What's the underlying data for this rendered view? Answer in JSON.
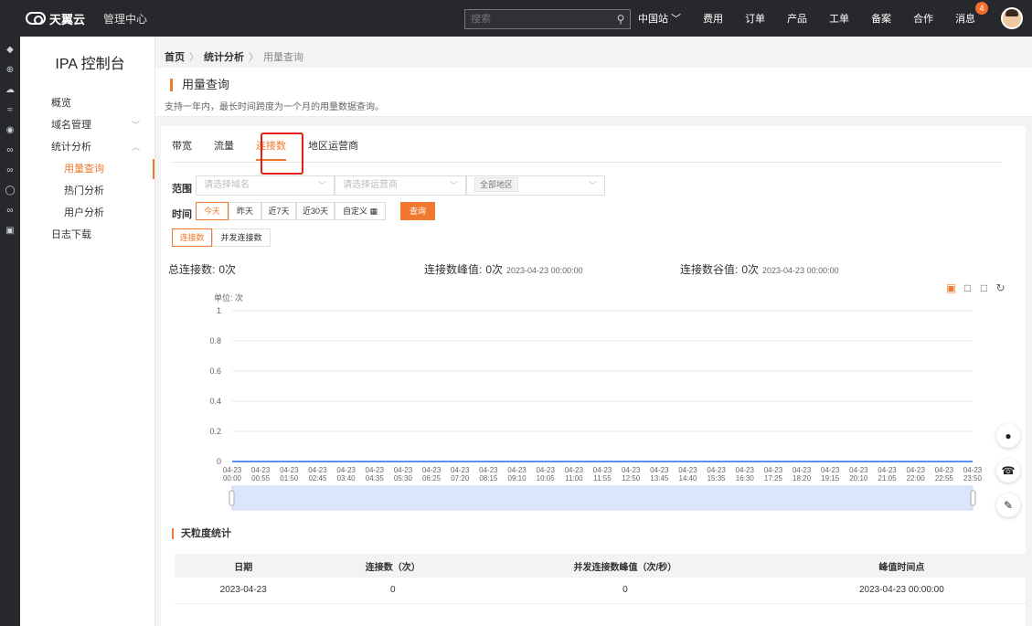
{
  "topbar": {
    "brand": "天翼云",
    "mgmt": "管理中心",
    "search_placeholder": "搜索",
    "nav": [
      "中国站",
      "费用",
      "订单",
      "产品",
      "工单",
      "备案",
      "合作"
    ],
    "messages_label": "消息",
    "messages_count": "4"
  },
  "sidebar": {
    "title": "IPA 控制台",
    "overview": "概览",
    "domain_mgmt": "域名管理",
    "stats": "统计分析",
    "sub": [
      "用量查询",
      "热门分析",
      "用户分析"
    ],
    "logs": "日志下载"
  },
  "breadcrumb": {
    "home": "首页",
    "stats": "统计分析",
    "current": "用量查询"
  },
  "header": {
    "title": "用量查询",
    "desc": "支持一年内，最长时间跨度为一个月的用量数据查询。"
  },
  "tabs": [
    "带宽",
    "流量",
    "连接数",
    "地区运营商"
  ],
  "filters": {
    "range_label": "范围",
    "domain_placeholder": "请选择域名",
    "isp_placeholder": "请选择运营商",
    "region_tag": "全部地区",
    "time_label": "时间",
    "time_buttons": [
      "今天",
      "昨天",
      "近7天",
      "近30天",
      "自定义 ▦"
    ],
    "query": "查询",
    "sub_tabs": [
      "连接数",
      "并发连接数"
    ]
  },
  "stats": {
    "total_label": "总连接数:",
    "total_value": "0次",
    "peak_label": "连接数峰值:",
    "peak_value": "0次",
    "peak_time": "2023-04-23 00:00:00",
    "valley_label": "连接数谷值:",
    "valley_value": "0次",
    "valley_time": "2023-04-23 00:00:00"
  },
  "chart_data": {
    "type": "line",
    "ylabel": "单位: 次",
    "ylim": [
      0,
      1
    ],
    "yticks": [
      "0",
      "0.2",
      "0.4",
      "0.6",
      "0.8",
      "1"
    ],
    "x": [
      "04-23 00:00",
      "04-23 00:55",
      "04-23 01:50",
      "04-23 02:45",
      "04-23 03:40",
      "04-23 04:35",
      "04-23 05:30",
      "04-23 06:25",
      "04-23 07:20",
      "04-23 08:15",
      "04-23 09:10",
      "04-23 10:05",
      "04-23 11:00",
      "04-23 11:55",
      "04-23 12:50",
      "04-23 13:45",
      "04-23 14:40",
      "04-23 15:35",
      "04-23 16:30",
      "04-23 17:25",
      "04-23 18:20",
      "04-23 19:15",
      "04-23 20:10",
      "04-23 21:05",
      "04-23 22:00",
      "04-23 22:55",
      "04-23 23:50"
    ],
    "series": [
      {
        "values": [
          0,
          0,
          0,
          0,
          0,
          0,
          0,
          0,
          0,
          0,
          0,
          0,
          0,
          0,
          0,
          0,
          0,
          0,
          0,
          0,
          0,
          0,
          0,
          0,
          0,
          0,
          0
        ],
        "color": "#5b8ff9"
      }
    ],
    "grid": true
  },
  "table": {
    "title": "天粒度统计",
    "headers": [
      "日期",
      "连接数（次）",
      "并发连接数峰值（次/秒）",
      "峰值时间点"
    ],
    "rows": [
      [
        "2023-04-23",
        "0",
        "0",
        "2023-04-23 00:00:00"
      ]
    ]
  },
  "colors": {
    "accent": "#f0792f",
    "topbar": "#26282b",
    "highlight": "#e0201b"
  }
}
